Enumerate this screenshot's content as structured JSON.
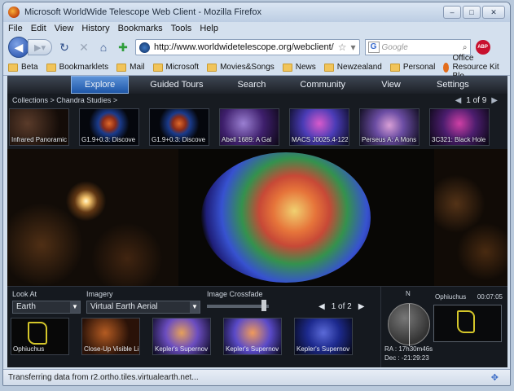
{
  "window": {
    "title": "Microsoft WorldWide Telescope Web Client - Mozilla Firefox",
    "controls": [
      "–",
      "□",
      "✕"
    ]
  },
  "menu": [
    "File",
    "Edit",
    "View",
    "History",
    "Bookmarks",
    "Tools",
    "Help"
  ],
  "nav": {
    "url": "http://www.worldwidetelescope.org/webclient/",
    "search_placeholder": "Google",
    "search_engine_letter": "G",
    "adblock_label": "ABP"
  },
  "bookmarks": [
    "Beta",
    "Bookmarklets",
    "Mail",
    "Microsoft",
    "Movies&Songs",
    "News",
    "Newzealand",
    "Personal",
    "Office Resource Kit Blo..."
  ],
  "app": {
    "tabs": [
      "Explore",
      "Guided Tours",
      "Search",
      "Community",
      "View",
      "Settings"
    ],
    "breadcrumb": "Collections  >  Chandra Studies  >",
    "pager": "1 of 9",
    "thumbnails": [
      "Infrared Panoramic",
      "G1.9+0.3: Discove",
      "G1.9+0.3: Discove",
      "Abell 1689:  A Gal",
      "MACS J0025.4-122",
      "Perseus A: A Mons",
      "3C321: Black Hole"
    ],
    "look_at_label": "Look At",
    "look_at_value": "Earth",
    "imagery_label": "Imagery",
    "imagery_value": "Virtual Earth Aerial",
    "crossfade_label": "Image Crossfade",
    "crossfade_value": 0.88,
    "bottom_pager": "1 of 2",
    "context_items": [
      "Ophiuchus",
      "Close-Up Visible Li",
      "Kepler's Supernov",
      "Kepler's Supernov",
      "Kepler's Supernov"
    ],
    "north_label": "N",
    "ra": "RA  : 17h30m46s",
    "dec": "Dec : -21:29:23",
    "constellation": "Ophiuchus",
    "time": "00:07:05"
  },
  "status": "Transferring data from r2.ortho.tiles.virtualearth.net..."
}
